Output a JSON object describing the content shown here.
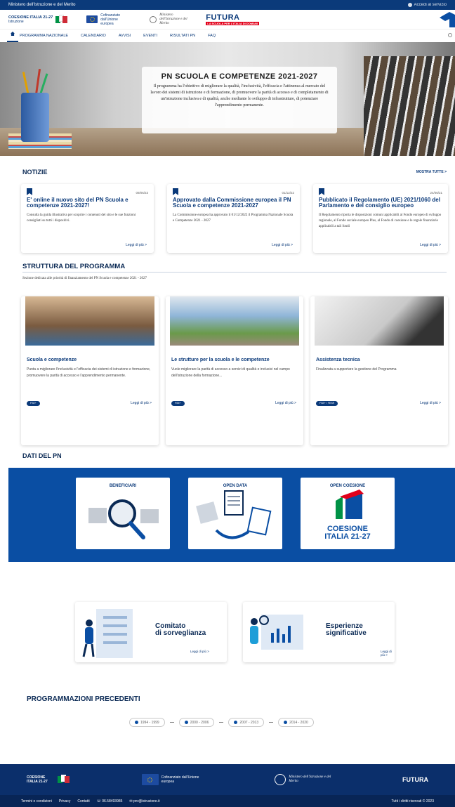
{
  "topbar": {
    "ministry": "Ministero dell'Istruzione e del Merito",
    "access": "Accedi al servizio"
  },
  "logos": {
    "coesione": "COESIONE ITALIA 21-27",
    "coesione_sub": "Istruzione",
    "eu": "Cofinanziato dall'Unione europea",
    "ministry": "Ministero dell'Istruzione e del Merito",
    "futura": "FUTURA",
    "futura_sub": "LA SCUOLA PER L'ITALIA DI DOMANI"
  },
  "nav": {
    "items": [
      "PROGRAMMA NAZIONALE",
      "CALENDARIO",
      "AVVISI",
      "EVENTI",
      "RISULTATI PN",
      "FAQ"
    ]
  },
  "hero": {
    "title": "PN SCUOLA E COMPETENZE 2021-2027",
    "text": "Il programma ha l'obiettivo di migliorare la qualità, l'inclusività, l'efficacia e l'attinenza al mercato del lavoro dei sistemi di istruzione e di formazione, di promuovere la parità di accesso e di completamento di un'istruzione inclusiva e di qualità, anche mediante lo sviluppo di infrastrutture, di potenziare l'apprendimento permanente."
  },
  "news": {
    "title": "NOTIZIE",
    "show_all": "MOSTRA TUTTE >",
    "items": [
      {
        "date": "09/06/23",
        "title": "E' online il nuovo sito del PN Scuola e competenze 2021-2027!",
        "text": "Consulta la guida illustrativa per scoprire i contenuti del sito e le sue funzioni consigliati su tutti i dispositivi.",
        "more": "Leggi di più  >"
      },
      {
        "date": "01/12/22",
        "title": "Approvato dalla Commissione europea il PN Scuola e competenze 2021-2027",
        "text": "La Commissione europea ha approvato il 01/12/2022 il Programma Nazionale Scuola e Competenze 2021 - 2027",
        "more": "Leggi di più  >"
      },
      {
        "date": "24/06/21",
        "title": "Pubblicato il Regolamento (UE) 2021/1060 del Parlamento e del consiglio europeo",
        "text": "Il Regolamento riporta le disposizioni comuni applicabili al Fondo europeo di sviluppo regionale, al Fondo sociale europeo Plus, al Fondo di coesione e le regole finanziarie applicabili a tali fondi",
        "more": "Leggi di più  >"
      }
    ]
  },
  "structure": {
    "title": "STRUTTURA DEL PROGRAMMA",
    "desc": "Sezione dedicata alle priorità di finanziamento del PN Scuola e competenze 2021 - 2027",
    "items": [
      {
        "title": "Scuola e competenze",
        "text": "Punta a migliorare l'inclusività e l'efficacia dei sistemi di istruzione e formazione, promuovere la parità di accesso e l'apprendimento permanente.",
        "tag": "FSE+",
        "more": "Leggi di più >"
      },
      {
        "title": "Le strutture per la scuola e le competenze",
        "text": "Vuole migliorare la parità di accesso a servizi di qualità e inclusivi nel campo dell'istruzione della formazione...",
        "tag": "FSE+",
        "more": "Leggi di più >"
      },
      {
        "title": "Assistenza tecnica",
        "text": "Finalizzata a supportare la gestione del Programma",
        "tag": "FSE+ / FESR",
        "more": "Leggi di più >"
      }
    ]
  },
  "dati": {
    "title": "DATI DEL PN",
    "cards": [
      "BENEFICIARI",
      "OPEN DATA",
      "OPEN COESIONE"
    ],
    "coesione_logo": "COESIONE",
    "coesione_logo2": "ITALIA 21-27"
  },
  "extra": [
    {
      "title1": "Comitato",
      "title2": "di sorveglianza",
      "more": "Leggi di più >"
    },
    {
      "title1": "Esperienze",
      "title2": "significative",
      "more": "Leggi di più >"
    }
  ],
  "previous": {
    "title": "PROGRAMMAZIONI PRECEDENTI",
    "items": [
      "1994 - 1999",
      "2000 - 2006",
      "2007 - 2013",
      "2014 - 2020"
    ]
  },
  "footer": {
    "coesione": "COESIONE ITALIA 21-27",
    "eu": "Cofinanziato dall'Unione europea",
    "ministry": "Ministero dell'Istruzione e del Merito",
    "futura": "FUTURA",
    "links": [
      "Termini e condizioni",
      "Privacy",
      "Contatti",
      "06.58493985",
      "pnr@istruzione.it"
    ],
    "rights": "Tutti i diritti riservati © 2023"
  },
  "colors": {
    "primary": "#0b3a7a",
    "band": "#0a4ea3",
    "footer": "#0b2f6b"
  }
}
